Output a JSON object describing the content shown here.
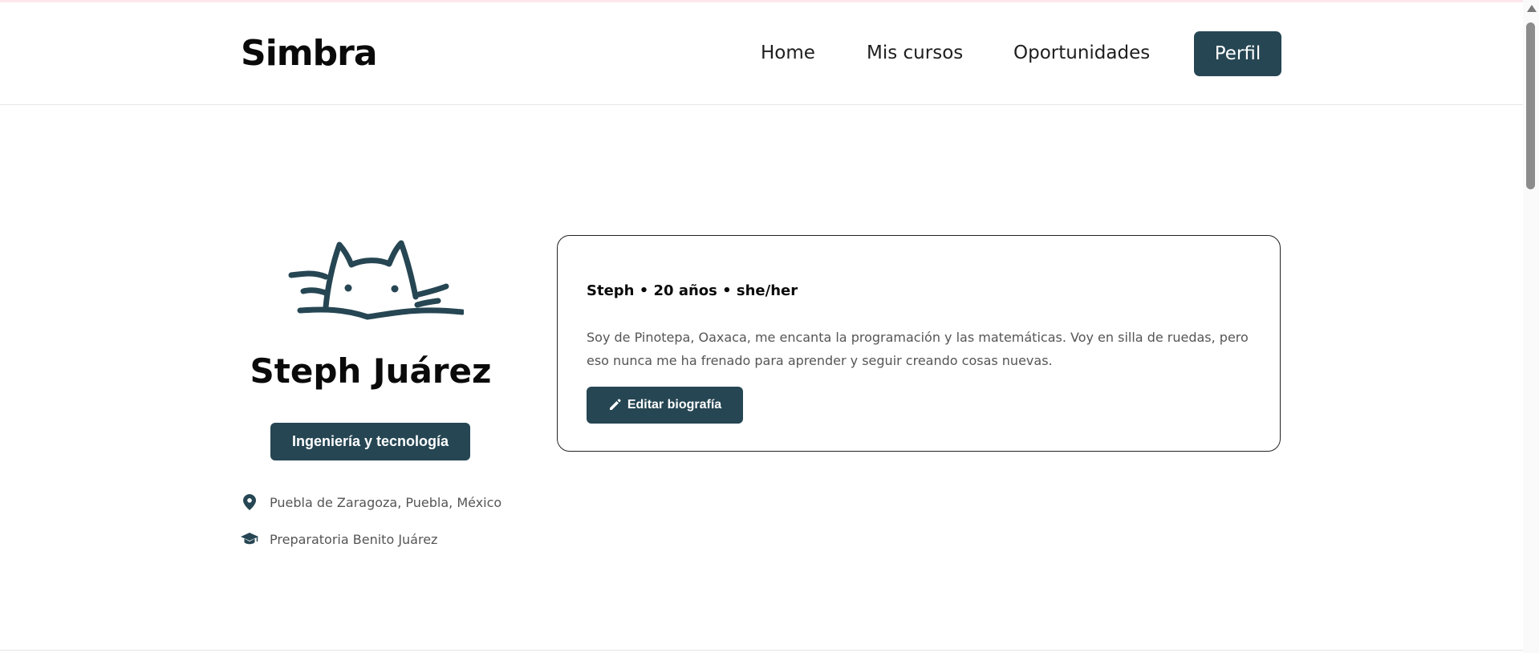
{
  "colors": {
    "accent": "#264653",
    "card_border": "#222222",
    "muted_text": "#555555"
  },
  "header": {
    "logo": "Simbra",
    "nav": [
      {
        "label": "Home"
      },
      {
        "label": "Mis cursos"
      },
      {
        "label": "Oportunidades"
      },
      {
        "label": "Perfil",
        "active": true
      }
    ]
  },
  "profile": {
    "avatar_icon": "cat-doodle-icon",
    "name": "Steph Juárez",
    "area": "Ingeniería y tecnología",
    "location": {
      "icon": "map-pin-icon",
      "text": "Puebla de Zaragoza, Puebla, México"
    },
    "school": {
      "icon": "graduation-cap-icon",
      "text": "Preparatoria Benito Juárez"
    }
  },
  "bio": {
    "heading": "Steph • 20 años • she/her",
    "text": "Soy de Pinotepa, Oaxaca, me encanta la programación y las matemáticas. Voy en silla de ruedas, pero eso nunca me ha frenado para aprender y seguir creando cosas nuevas.",
    "edit_button": {
      "icon": "pencil-icon",
      "label": "Editar biografía"
    }
  }
}
